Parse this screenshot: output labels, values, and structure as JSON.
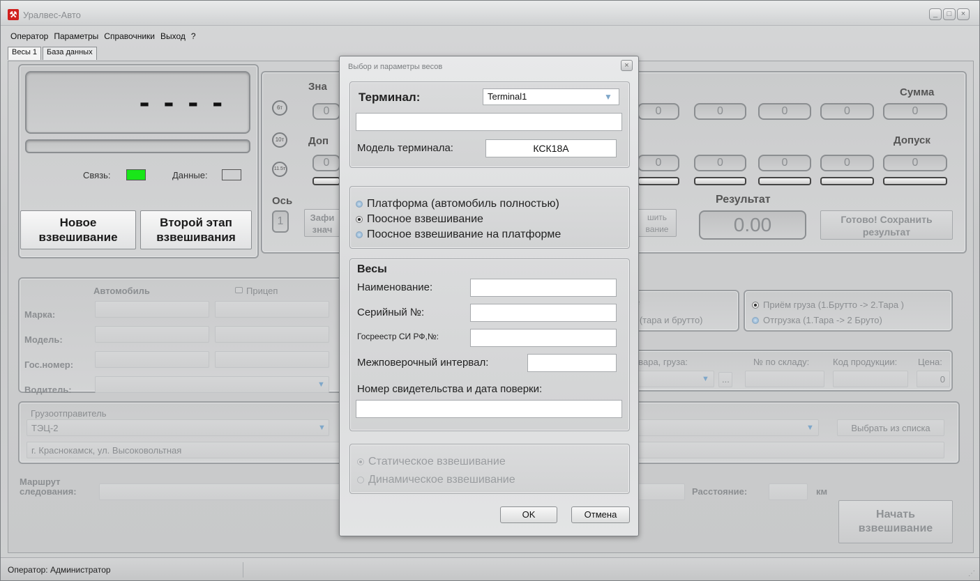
{
  "window": {
    "title": "Уралвес-Авто",
    "icon": "hammer-wrench-icon",
    "controls": [
      "_",
      "□",
      "×"
    ]
  },
  "menu": [
    "Оператор",
    "Параметры",
    "Справочники",
    "Выход",
    "?"
  ],
  "tabs": [
    "Весы 1",
    "База данных"
  ],
  "display": {
    "reading": "- - - -",
    "link_label": "Связь:",
    "data_label": "Данные:",
    "link_color": "#19e619",
    "data_color": "#cfd0d1"
  },
  "buttons": {
    "new_weighing": "Новое взвешивание",
    "second_stage": "Второй этап взвешивания",
    "fix_partial": "Зафи знач",
    "finish_partial": "шить вание",
    "done_save": "Готово! Сохранить результат",
    "start_weighing": "Начать взвешивание",
    "choose_from_list": "Выбрать из списка",
    "ellipsis": "..."
  },
  "axles": {
    "value_label": "Зна",
    "tolerance_label_partial": "Доп",
    "sum_label": "Сумма",
    "tolerance_label": "Допуск",
    "axle_label": "Ось",
    "axle_number": "1",
    "axle_icons": [
      "6т",
      "10т",
      "11.5т"
    ],
    "values_row1": [
      "0",
      "0",
      "0",
      "0",
      "0",
      "0"
    ],
    "values_row2": [
      "0",
      "0",
      "0",
      "0",
      "0",
      "0"
    ],
    "result_label": "Результат",
    "result_value": "0.00"
  },
  "vehicle": {
    "col_vehicle": "Автомобиль",
    "col_trailer": "Прицеп",
    "make_label": "Марка:",
    "model_label": "Модель:",
    "plate_label": "Гос.номер:",
    "driver_label": "Водитель:"
  },
  "mode": {
    "partial_top": "е",
    "partial_bottom": "а (тара и брутто)",
    "receive": "Приём груза  (1.Брутто -> 2.Тара )",
    "ship": "Отгрузка      (1.Тара   -> 2 Бруто)"
  },
  "goods": {
    "goods_label": "овара, груза:",
    "warehouse_label": "№ по складу:",
    "product_code_label": "Код продукции:",
    "price_label": "Цена:",
    "price_value": "0"
  },
  "shipper": {
    "label": "Грузоотправитель",
    "value": "ТЭЦ-2",
    "address": "г. Краснокамск, ул. Высоковольтная"
  },
  "route": {
    "label": "Маршрут следования:",
    "distance_label": "Расстояние:",
    "distance_unit": "км"
  },
  "status": {
    "operator": "Оператор: Администратор"
  },
  "dialog": {
    "title": "Выбор и параметры весов",
    "terminal_label": "Терминал:",
    "terminal_value": "Terminal1",
    "terminal_extra": "",
    "terminal_model_label": "Модель терминала:",
    "terminal_model_value": "КСК18А",
    "weigh_modes": [
      "Платформа (автомобиль полностью)",
      "Поосное взвешивание",
      "Поосное взвешивание на платформе"
    ],
    "selected_weigh_mode": 1,
    "scales_header": "Весы",
    "name_label": "Наименование:",
    "serial_label": "Серийный №:",
    "registry_label": "Госреестр СИ РФ,№:",
    "interval_label": "Межповерочный интервал:",
    "certificate_label": "Номер свидетельства и дата поверки:",
    "static": "Статическое взвешивание",
    "dynamic": "Динамическое взвешивание",
    "ok": "OK",
    "cancel": "Отмена"
  }
}
